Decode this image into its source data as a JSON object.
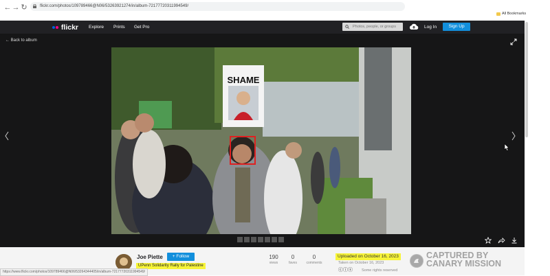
{
  "browser": {
    "url": "flickr.com/photos/109789466@N06/53263921274/in/album-72177720311994549/",
    "bookmarks_label": "All Bookmarks"
  },
  "header": {
    "logo_text": "flickr",
    "nav": [
      "Explore",
      "Prints",
      "Get Pro"
    ],
    "search_placeholder": "Photos, people, or groups",
    "login": "Log In",
    "signup": "Sign Up"
  },
  "viewer": {
    "back_label": "Back to album",
    "photo_sign_text": "SHAME"
  },
  "photo_info": {
    "author": "Joe Piette",
    "follow_label": "+ Follow",
    "title": "UPenn Solidarity Rally for Palestine",
    "stats": [
      {
        "value": "190",
        "label": "views"
      },
      {
        "value": "0",
        "label": "faves"
      },
      {
        "value": "0",
        "label": "comments"
      }
    ],
    "uploaded": "Uploaded on October 16, 2023",
    "taken": "Taken on October 16, 2023",
    "rights": "Some rights reserved",
    "license_icons": "ⓒⓘⓢ"
  },
  "watermark": {
    "line1": "CAPTURED BY",
    "line2": "CANARY MISSION"
  },
  "status_bar_url": "https://www.flickr.com/photos/109789466@N06/53264344405/in/album-72177720311994549/",
  "colors": {
    "flickr_blue": "#128fdc",
    "flickr_pink": "#ff0084",
    "highlight_yellow": "#f7f438",
    "face_box_red": "#e02020"
  }
}
